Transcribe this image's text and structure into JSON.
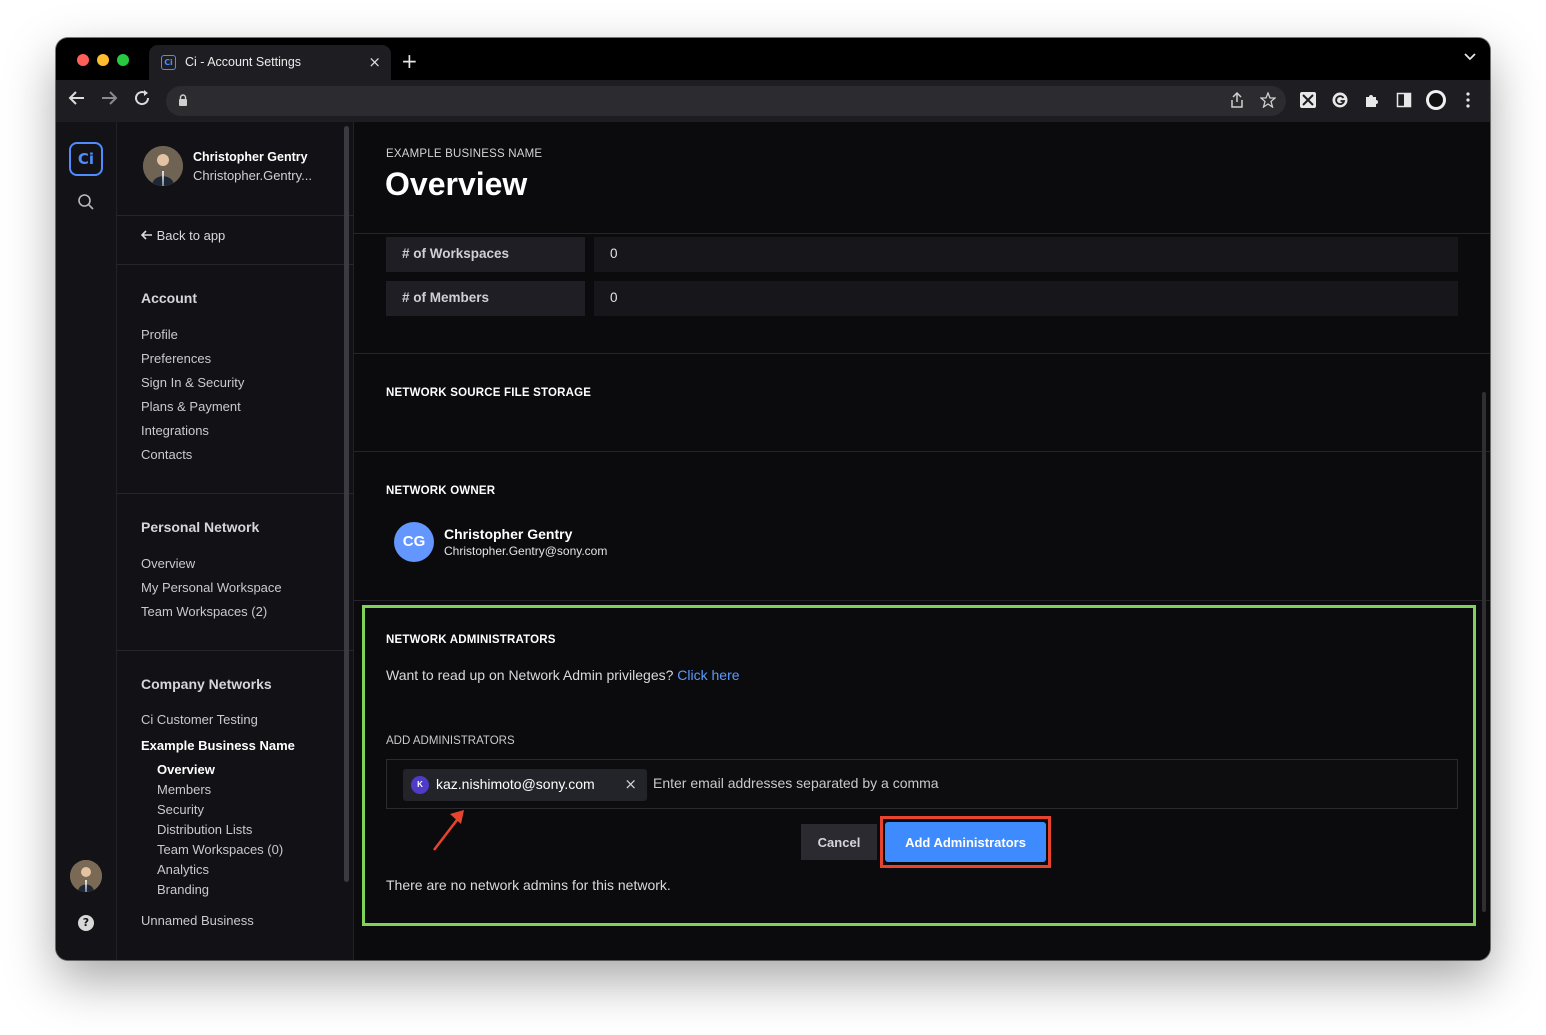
{
  "browser": {
    "tab_title": "Ci - Account Settings",
    "tab_favicon_letter": "Ci",
    "new_tab_label": "+",
    "close_tab_label": "×",
    "address": ""
  },
  "rail": {
    "logo_label": "Ci"
  },
  "sidebar": {
    "user_name": "Christopher Gentry",
    "user_email": "Christopher.Gentry...",
    "back_label": "Back to app",
    "account": {
      "title": "Account",
      "items": [
        "Profile",
        "Preferences",
        "Sign In & Security",
        "Plans & Payment",
        "Integrations",
        "Contacts"
      ]
    },
    "personal": {
      "title": "Personal Network",
      "items": [
        "Overview",
        "My Personal Workspace",
        "Team Workspaces (2)"
      ]
    },
    "company": {
      "title": "Company Networks",
      "items": [
        "Ci Customer Testing",
        "Example Business Name"
      ],
      "subitems": [
        "Overview",
        "Members",
        "Security",
        "Distribution Lists",
        "Team Workspaces (0)",
        "Analytics",
        "Branding"
      ],
      "extra": "Unnamed Business"
    }
  },
  "main": {
    "business_label": "EXAMPLE BUSINESS NAME",
    "page_title": "Overview",
    "stats": [
      {
        "label": "# of Workspaces",
        "value": "0"
      },
      {
        "label": "# of Members",
        "value": "0"
      }
    ],
    "storage_title": "NETWORK SOURCE FILE STORAGE",
    "owner": {
      "title": "NETWORK OWNER",
      "initials": "CG",
      "name": "Christopher Gentry",
      "email": "Christopher.Gentry@sony.com"
    },
    "admins": {
      "title": "NETWORK ADMINISTRATORS",
      "help_text": "Want to read up on Network Admin privileges?",
      "help_link": "Click here",
      "add_label": "ADD ADMINISTRATORS",
      "chip_initial": "K",
      "chip_email": "kaz.nishimoto@sony.com",
      "placeholder": "Enter email addresses separated by a comma",
      "cancel_label": "Cancel",
      "add_label_btn": "Add Administrators",
      "empty_text": "There are no network admins for this network."
    }
  },
  "colors": {
    "accent": "#3d8bff",
    "highlight_green": "#7fd35a",
    "highlight_red": "#e8442d"
  }
}
